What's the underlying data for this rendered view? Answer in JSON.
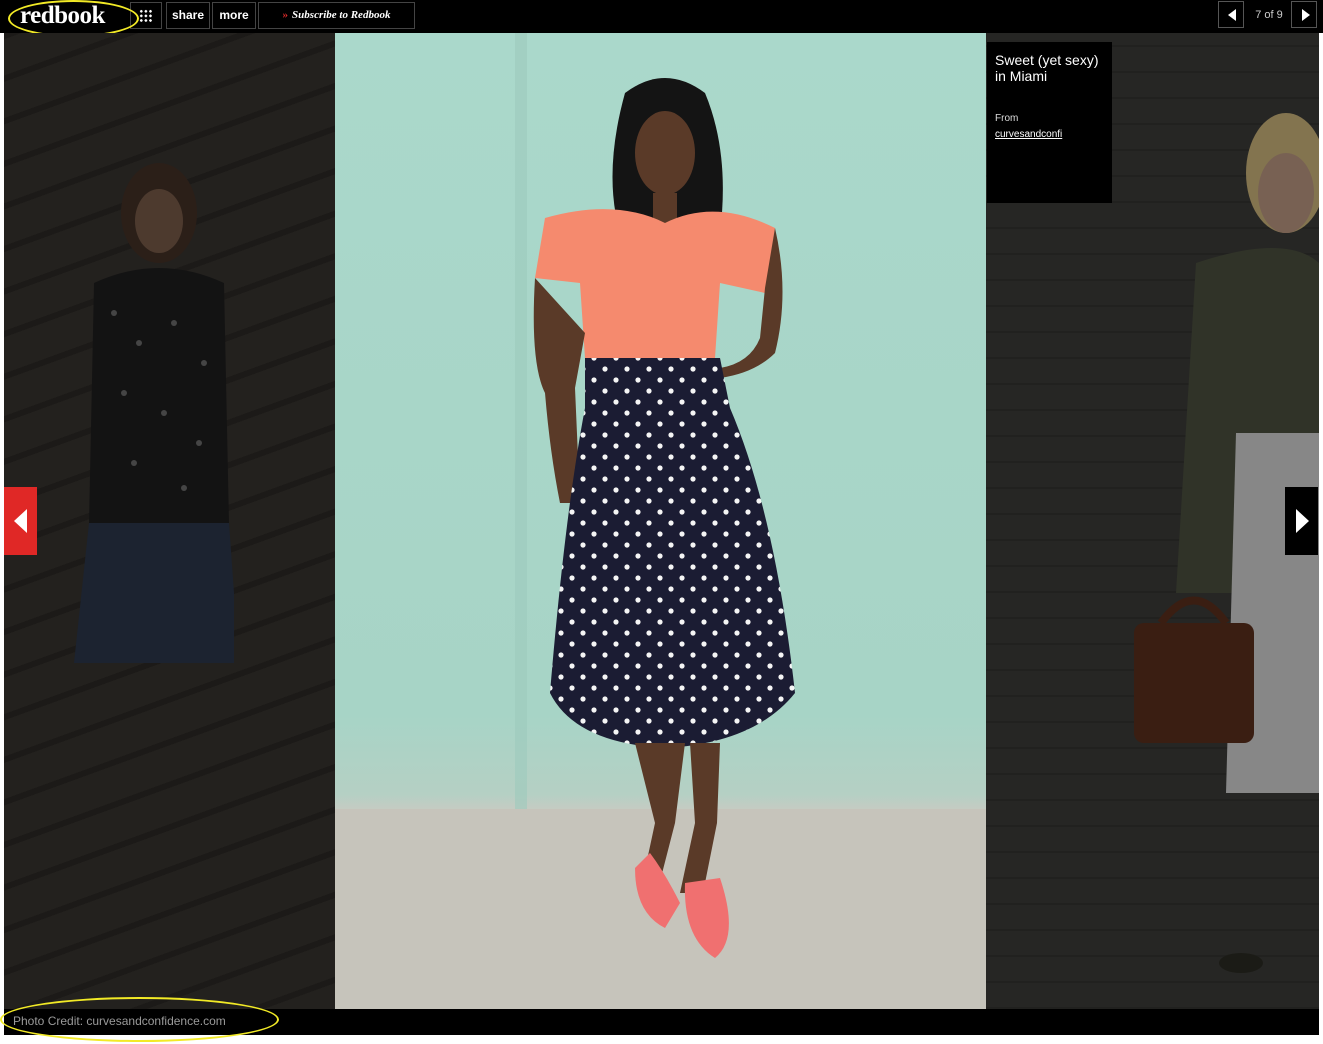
{
  "header": {
    "logo_text": "redbook",
    "share_label": "share",
    "more_label": "more",
    "subscribe_chevron": "»",
    "subscribe_label": "Subscribe to Redbook",
    "counter_text": "7 of 9",
    "grid_icon": "grid-icon",
    "prev_icon": "triangle-left-icon",
    "next_icon": "triangle-right-icon"
  },
  "slide": {
    "title": "Sweet (yet sexy) in Miami",
    "from_label": "From",
    "source_link": "curvesandconfi",
    "photo_credit": "Photo Credit: curvesandconfidence.com"
  },
  "colors": {
    "prev_arrow_bg": "#e02826",
    "highlight_outline": "#f2ea26",
    "subscribe_chevron": "#e12b2b"
  }
}
